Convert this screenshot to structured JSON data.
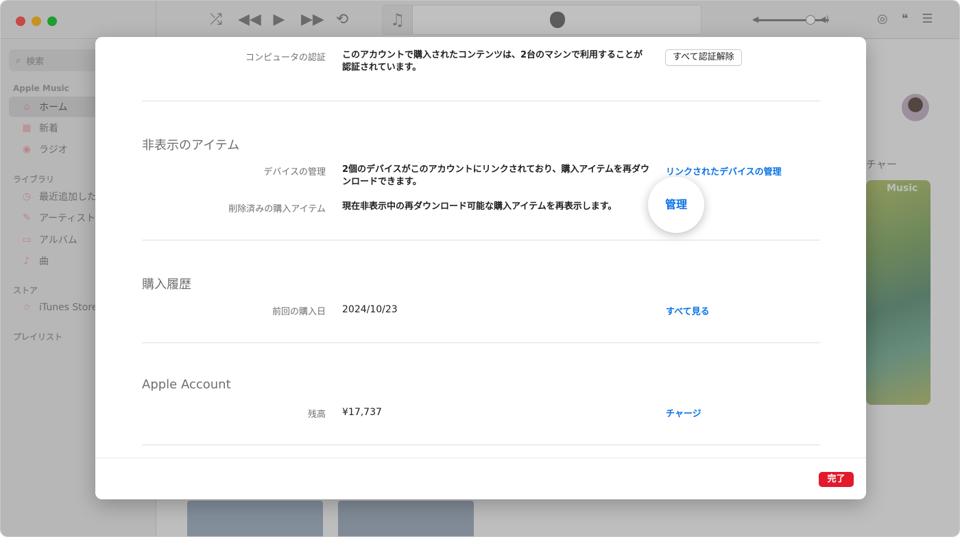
{
  "toolbar": {
    "shuffle_icon": "shuffle-icon",
    "prev_icon": "backward-icon",
    "play_icon": "play-icon",
    "next_icon": "forward-icon",
    "repeat_icon": "repeat-icon"
  },
  "sidebar": {
    "search_placeholder": "検索",
    "section_apple_music": "Apple Music",
    "item_home": "ホーム",
    "item_new": "新着",
    "item_radio": "ラジオ",
    "section_library": "ライブラリ",
    "item_recent": "最近追加した",
    "item_artists": "アーティスト",
    "item_albums": "アルバム",
    "item_songs": "曲",
    "section_store": "ストア",
    "item_itunes": "iTunes Store",
    "section_playlists": "プレイリスト"
  },
  "content": {
    "feature_label": "チャー",
    "art_brand": "Music"
  },
  "sheet": {
    "computer_auth": {
      "label": "コンピュータの認証",
      "text": "このアカウントで購入されたコンテンツは、2台のマシンで利用することが認証されています。",
      "button": "すべて認証解除"
    },
    "hidden_items": {
      "title": "非表示のアイテム",
      "device_label": "デバイスの管理",
      "device_text": "2個のデバイスがこのアカウントにリンクされており、購入アイテムを再ダウンロードできます。",
      "device_link": "リンクされたデバイスの管理",
      "deleted_label": "削除済みの購入アイテム",
      "deleted_text": "現在非表示中の再ダウンロード可能な購入アイテムを再表示します。",
      "deleted_link": "管理"
    },
    "purchase_history": {
      "title": "購入履歴",
      "last_label": "前回の購入日",
      "last_value": "2024/10/23",
      "link": "すべて見る"
    },
    "apple_account": {
      "title": "Apple Account",
      "balance_label": "残高",
      "balance_value": "¥17,737",
      "link": "チャージ"
    },
    "done_button": "完了"
  },
  "colors": {
    "link": "#0a72e6",
    "done": "#e21a2c",
    "sidebar_icon": "#f3a7ae"
  }
}
